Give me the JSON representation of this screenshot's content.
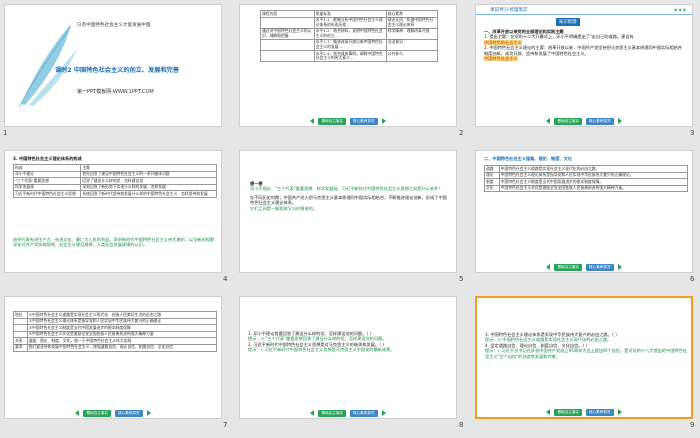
{
  "slides": [
    {
      "num": "1",
      "motto": "只有中国特色社会主义才能发展中国",
      "lesson": "课时2 中国特色社会主义的创立、发展和完善",
      "site": "第一PPT模板网-WWW.1PPT.COM"
    },
    {
      "num": "2",
      "headers": [
        "课程内容",
        "质量标准",
        "核心素养"
      ],
      "rows": [
        [
          "",
          "水平1-1：能够分析中国特色社会主义理论体系的形成历程…",
          "政治认同：知道中国特色社会主义理论体系"
        ],
        [
          "通过对中国特色社会主义的认识，理解和把握",
          "水平1-2：结合材料，说明中国特色社会主义的创立…",
          "科学精神：理解改革开放"
        ],
        [
          "",
          "水平1-3：概述改革开放以来中国特色社会主义的发展…",
          "法治意识"
        ],
        [
          "",
          "水平2-4：结合具体事例，阐释中国特色社会主义的伟大意义…",
          "公共参与"
        ]
      ]
    },
    {
      "num": "3",
      "tab": "课前预习·梳理落实",
      "section": "知识梳理",
      "lines": [
        "一、改革开放以来党的全部理论和实践主题",
        "1. 提出主题：在党的十二大开幕式上，邓小平明确提出了\"走自己的道路，建设有",
        "中国特色的社会主义\"这一鲜明主题。",
        "2. 中国特色社会主义理论的主要：改革开放以来，中国共产党坚持把马克思主义基本原理同中国实际相结合",
        "制度创新，成功开辟、坚持和发展了中国特色社会主义。"
      ],
      "hl": [
        "中国特色的社会主义",
        "中国特色社会主义"
      ]
    },
    {
      "num": "4",
      "title": "3. 中国特色社会主义理论体系的构成",
      "headers": [
        "构成",
        "主题"
      ],
      "rows": [
        [
          "邓小平理论",
          "首先回答了建设中国特色社会主义的一系列基本问题"
        ],
        [
          "\"三个代表\"重要思想",
          "回答了建设什么样的党、怎样建设党"
        ],
        [
          "科学发展观",
          "深刻回答了新形势下实现什么样的发展、怎样发展"
        ],
        [
          "习近平新时代中国特色社会主义思想",
          "系统回答了新时代坚持和发展什么样的中国特色社会主义、怎样坚持和发展"
        ]
      ],
      "note": "始终代表先进生产力、先进文化、最广大人民的利益。高举新时代中国特色社会主义伟大旗帜，以全新的视野深化对共产党执政规律、社会主义建设规律、人类社会发展规律的认识。"
    },
    {
      "num": "5",
      "q_title": "想一想",
      "q_text": "邓小平理论、\"三个代表\"重要思想、科学发展观、习近平新时代中国特色社会主义思想之间是什么关系？",
      "a_text": "在不同历史时期，中国共产党人把马克思主义基本原理同中国实际相结合，不断推进理论创新，形成了中国特色社会主义理论体系。",
      "a_tail": "它们之间是一脉相承又与时俱进的。"
    },
    {
      "num": "6",
      "title": "二、中国特色社会主义道路、理论、制度、文化",
      "rows": [
        [
          "道路",
          "中国特色社会主义道路是实现社会主义现代化的必由之路。"
        ],
        [
          "理论",
          "中国特色社会主义理论体系是指导党和人民实现中华民族伟大复兴的正确理论。"
        ],
        [
          "制度",
          "中国特色社会主义制度是当代中国发展进步的根本制度保障。"
        ],
        [
          "文化",
          "中国特色社会主义文化是激励全党全国各族人民奋勇前进的强大精神力量。"
        ]
      ]
    },
    {
      "num": "7",
      "rows": [
        [
          "地位",
          "①中国特色社会主义道路是实现社会主义现代化、创造人民美好生活的必由之路"
        ],
        [
          "",
          "②中国特色社会主义理论体系是指导党和人民实现中华民族伟大复兴的正确理论"
        ],
        [
          "",
          "③中国特色社会主义制度是当代中国发展进步的根本制度保障"
        ],
        [
          "",
          "④中国特色社会主义文化是激励全党全国各族人民奋勇前进的强大精神力量"
        ],
        [
          "关系",
          "道路、理论、制度、文化，统一于中国特色社会主义伟大实践"
        ],
        [
          "要求",
          "我们要坚持和发展中国特色社会主义，增强道路自信、理论自信、制度自信、文化自信"
        ]
      ]
    },
    {
      "num": "8",
      "lines": [
        "1. 邓小平理论首要回答了建设什么样的党、怎样建设党的问题。（ ）",
        "提示：× \"三个代表\"重要思想回答了建设什么样的党、怎样建设党的问题。",
        "2. 习近平新时代中国特色社会主义思想是对马克思主义的继承和发展。（ ）",
        "提示：√ 习近平新时代中国特色社会主义思想是马克思主义中国化的最新成果。"
      ]
    },
    {
      "num": "9",
      "lines": [
        "3. 中国特色社会主义理论体系是实现中华民族伟大复兴的必由之路。（ ）",
        "提示：× 中国特色社会主义道路是实现社会主义现代化的必由之路。",
        "4. 坚定道路自信、理论自信、制度自信、文化自信。（ ）",
        "提示：√ 习近平总书记在庆祝中国共产党成立95周年大会上提出四个自信，是对党的十八大提出的中国特色社会主义\"三个自信\"的创造性发展和完善。"
      ]
    }
  ],
  "footer": {
    "btn1": "基础自主落实",
    "btn2": "核心素养探究"
  }
}
